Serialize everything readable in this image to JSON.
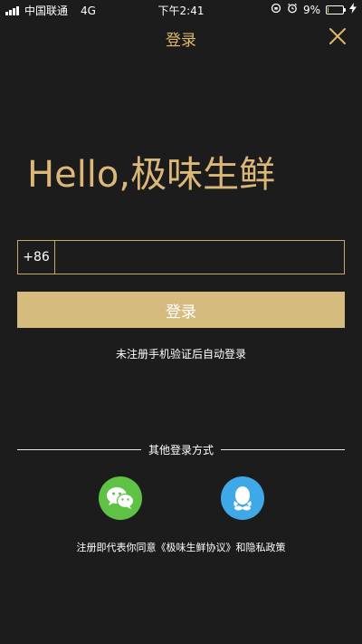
{
  "status_bar": {
    "carrier": "中国联通",
    "network": "4G",
    "time": "下午2:41",
    "battery_text": "9%",
    "battery_level": 0.09
  },
  "header": {
    "title": "登录"
  },
  "hero": {
    "greeting": "Hello,极味生鲜"
  },
  "phone": {
    "country_code": "+86",
    "value": "",
    "placeholder": ""
  },
  "login_button": {
    "label": "登录"
  },
  "hint": "未注册手机验证后自动登录",
  "other_login": {
    "label": "其他登录方式"
  },
  "agreement": "注册即代表你同意《极味生鲜协议》和隐私政策",
  "colors": {
    "background": "#1c1c1c",
    "accent_gold": "#ddb76d",
    "button_gold": "#d6bb7f",
    "wechat_green": "#5fc244",
    "qq_blue": "#3fa9e8"
  },
  "icons": {
    "close": "close-icon",
    "wechat": "wechat-icon",
    "qq": "qq-icon"
  }
}
